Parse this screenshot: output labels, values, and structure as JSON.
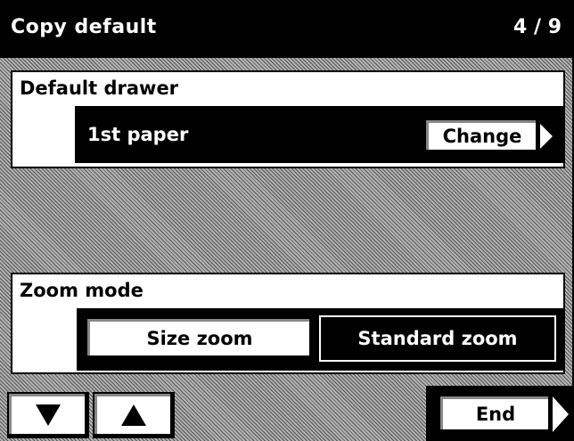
{
  "header": {
    "title": "Copy default",
    "page_indicator": "4 / 9"
  },
  "default_drawer": {
    "label": "Default drawer",
    "value": "1st paper",
    "change_button": "Change"
  },
  "zoom_mode": {
    "label": "Zoom mode",
    "options": [
      "Size zoom",
      "Standard zoom"
    ],
    "selected": "Standard zoom"
  },
  "footer": {
    "down_icon": "triangle-down-icon",
    "up_icon": "triangle-up-icon",
    "end_button": "End"
  }
}
